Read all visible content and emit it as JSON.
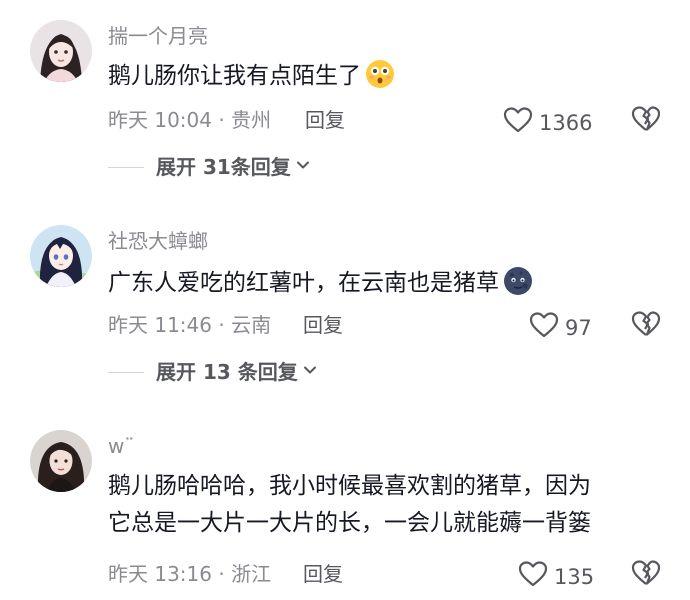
{
  "comments": [
    {
      "username": "揣一个月亮",
      "text": "鹅儿肠你让我有点陌生了",
      "emoji": "flushed-face-emoji",
      "meta": "昨天 10:04 · 贵州",
      "reply": "回复",
      "likes": "1366",
      "expand": "展开 31条回复"
    },
    {
      "username": "社恐大蟑螂",
      "text": "广东人爱吃的红薯叶，在云南也是猪草",
      "emoji": "dark-moon-face-emoji",
      "meta": "昨天 11:46 · 云南",
      "reply": "回复",
      "likes": "97",
      "expand": "展开 13 条回复"
    },
    {
      "username": "w¨",
      "text_line1": "鹅儿肠哈哈哈，我小时候最喜欢割的猪草，因为",
      "text_line2": "它总是一大片一大片的长，一会儿就能薅一背篓",
      "meta": "昨天 13:16 · 浙江",
      "reply": "回复",
      "likes": "135"
    }
  ],
  "icons": {
    "like": "heart-outline-icon",
    "dislike": "broken-heart-icon",
    "expand": "chevron-down-icon"
  },
  "colors": {
    "text": "#161823",
    "secondary": "#8a8b91",
    "action": "#57585e"
  }
}
